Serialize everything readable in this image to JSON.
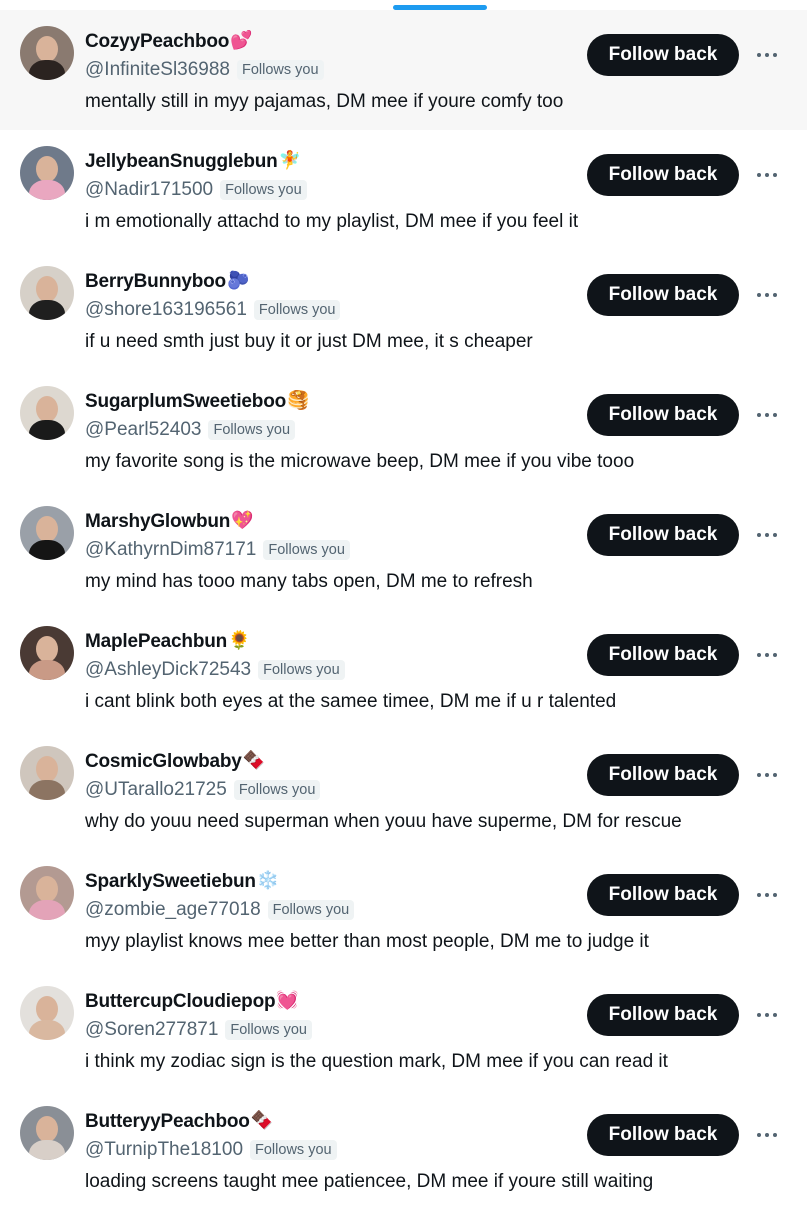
{
  "users": [
    {
      "name": "CozyyPeachboo",
      "emoji": "💕",
      "emoji_color": "#e0245e",
      "handle": "@InfiniteSl36988",
      "badge": "Follows you",
      "bio": "mentally still in myy pajamas, DM mee if youre comfy too",
      "button": "Follow back",
      "avatar_bg": "#8a7a70",
      "avatar_top": "#2b2320",
      "highlighted": true
    },
    {
      "name": "JellybeanSnugglebun",
      "emoji": "🧚",
      "emoji_color": "#f4a742",
      "handle": "@Nadir171500",
      "badge": "Follows you",
      "bio": "i m emotionally attachd to my playlist, DM mee if you feel it",
      "button": "Follow back",
      "avatar_bg": "#6f7a8a",
      "avatar_top": "#e9a7c0"
    },
    {
      "name": "BerryBunnyboo",
      "emoji": "🫐",
      "emoji_color": "#4b5fb8",
      "handle": "@shore163196561",
      "badge": "Follows you",
      "bio": "if u need smth just buy it or just DM mee, it s cheaper",
      "button": "Follow back",
      "avatar_bg": "#d6d0c8",
      "avatar_top": "#1f1f1f"
    },
    {
      "name": "SugarplumSweetieboo",
      "emoji": "🥞",
      "emoji_color": "#d98c2b",
      "handle": "@Pearl52403",
      "badge": "Follows you",
      "bio": "my favorite song is the microwave beep, DM mee if you vibe tooo",
      "button": "Follow back",
      "avatar_bg": "#ddd8d0",
      "avatar_top": "#1a1a1a"
    },
    {
      "name": "MarshyGlowbun",
      "emoji": "💖",
      "emoji_color": "#e0245e",
      "handle": "@KathyrnDim87171",
      "badge": "Follows you",
      "bio": "my mind has tooo many tabs open, DM me to refresh",
      "button": "Follow back",
      "avatar_bg": "#9aa0a8",
      "avatar_top": "#151515"
    },
    {
      "name": "MaplePeachbun",
      "emoji": "🌻",
      "emoji_color": "#f2b01e",
      "handle": "@AshleyDick72543",
      "badge": "Follows you",
      "bio": "i cant blink both eyes at the samee timee, DM me if u r talented",
      "button": "Follow back",
      "avatar_bg": "#4a3a34",
      "avatar_top": "#c99a86"
    },
    {
      "name": "CosmicGlowbaby",
      "emoji": "🍫",
      "emoji_color": "#b5302a",
      "handle": "@UTarallo21725",
      "badge": "Follows you",
      "bio": "why do youu need superman when youu have superme, DM for rescue",
      "button": "Follow back",
      "avatar_bg": "#cfc6bd",
      "avatar_top": "#8c7462"
    },
    {
      "name": "SparklySweetiebun",
      "emoji": "❄️",
      "emoji_color": "#7fc6f2",
      "handle": "@zombie_age77018",
      "badge": "Follows you",
      "bio": "myy playlist knows mee better than most people, DM me to judge it",
      "button": "Follow back",
      "avatar_bg": "#b39a92",
      "avatar_top": "#e3a3b8"
    },
    {
      "name": "ButtercupCloudiepop",
      "emoji": "💓",
      "emoji_color": "#e0245e",
      "handle": "@Soren277871",
      "badge": "Follows you",
      "bio": "i think my zodiac sign is the question mark, DM mee if you can read it",
      "button": "Follow back",
      "avatar_bg": "#e3e0dc",
      "avatar_top": "#d9b8a0"
    },
    {
      "name": "ButteryyPeachboo",
      "emoji": "🍫",
      "emoji_color": "#b5302a",
      "handle": "@TurnipThe18100",
      "badge": "Follows you",
      "bio": "loading screens taught mee patiencee, DM mee if youre still waiting",
      "button": "Follow back",
      "avatar_bg": "#8a8f96",
      "avatar_top": "#d8cfc8"
    }
  ]
}
